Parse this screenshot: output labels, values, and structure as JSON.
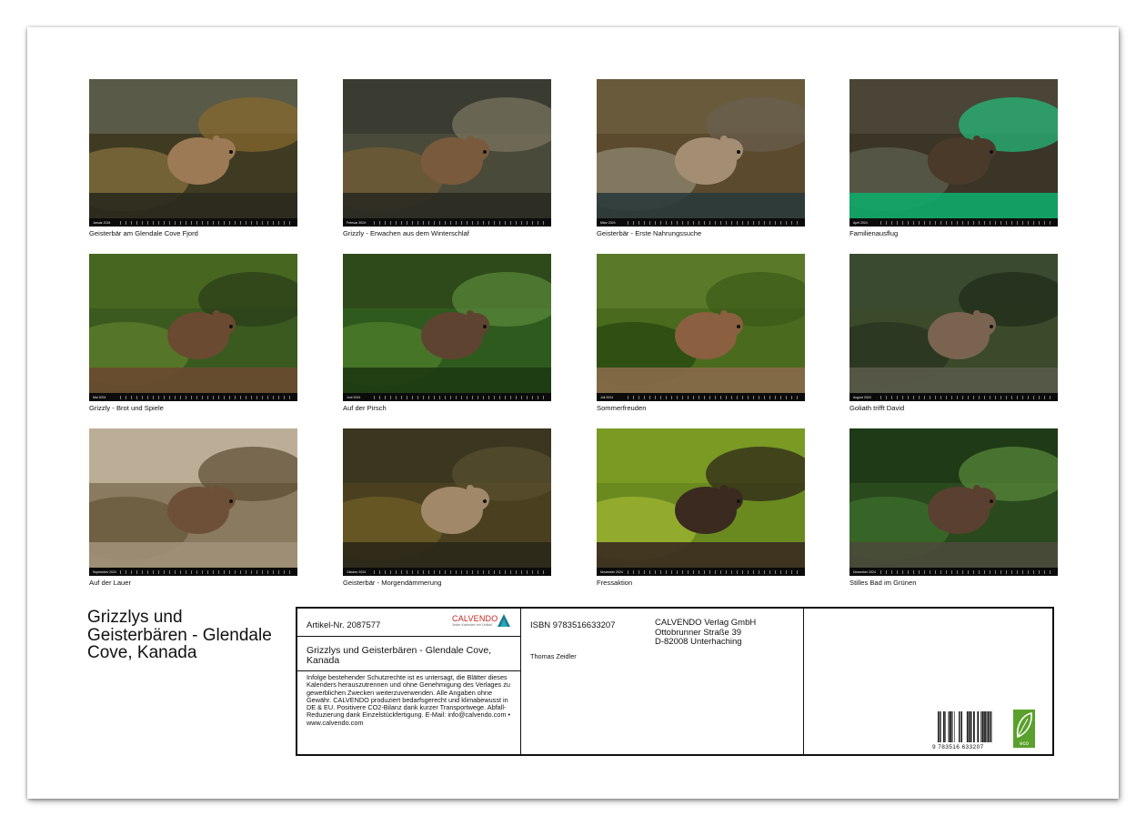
{
  "months": [
    {
      "caption": "Geisterbär am Glendale Cove Fjord",
      "strip": "Januar 2024",
      "colors": [
        "#3f3a22",
        "#7b6a3a",
        "#2a2a1e",
        "#8a6a2e"
      ],
      "bear": "#9c7a55",
      "top": "#5a5a48"
    },
    {
      "caption": "Grizzly - Erwachen aus dem Winterschlaf",
      "strip": "Februar 2024",
      "colors": [
        "#4a4a3a",
        "#6e5a36",
        "#2b2a22",
        "#7c7660"
      ],
      "bear": "#7a5a3c",
      "top": "#3a3c32"
    },
    {
      "caption": "Geisterbär - Erste Nahrungssuche",
      "strip": "März 2024",
      "colors": [
        "#5b4a2e",
        "#8a8068",
        "#2a3a3a",
        "#6a6050"
      ],
      "bear": "#a38e74",
      "top": "#6a5a3c"
    },
    {
      "caption": "Familienausflug",
      "strip": "April 2024",
      "colors": [
        "#3b3528",
        "#5a5a4a",
        "#0faa6a",
        "#22c07e"
      ],
      "bear": "#4a3a2a",
      "top": "#4a4536"
    },
    {
      "caption": "Grizzly - Brot und Spiele",
      "strip": "Mai 2024",
      "colors": [
        "#3a5a20",
        "#5a7a2a",
        "#6a4a30",
        "#2a3a18"
      ],
      "bear": "#6a4a30",
      "top": "#47661f"
    },
    {
      "caption": "Auf der Pirsch",
      "strip": "Juni 2024",
      "colors": [
        "#2f5a1e",
        "#4a7a2a",
        "#1e3a12",
        "#5a8a3a"
      ],
      "bear": "#5e4430",
      "top": "#2f4a1a"
    },
    {
      "caption": "Sommerfreuden",
      "strip": "Juli 2024",
      "colors": [
        "#4a6a1e",
        "#2a4a12",
        "#8a6a4a",
        "#3a5a18"
      ],
      "bear": "#8a6040",
      "top": "#5a7a2a"
    },
    {
      "caption": "Goliath trifft David",
      "strip": "August 2024",
      "colors": [
        "#3a4a2a",
        "#2a3520",
        "#5a5a4a",
        "#1e2a18"
      ],
      "bear": "#7a6450",
      "top": "#3a4a30"
    },
    {
      "caption": "Auf der Lauer",
      "strip": "September 2024",
      "colors": [
        "#8a7a60",
        "#6a5a3e",
        "#a09078",
        "#5a4a30"
      ],
      "bear": "#6e5038",
      "top": "#bcae96"
    },
    {
      "caption": "Geisterbär - Morgendämmerung",
      "strip": "Oktober 2024",
      "colors": [
        "#4a4020",
        "#6a5a26",
        "#2a2818",
        "#5a5030"
      ],
      "bear": "#a08868",
      "top": "#3a3620"
    },
    {
      "caption": "Fressaktion",
      "strip": "November 2024",
      "colors": [
        "#6a8a20",
        "#9ab030",
        "#3a2a20",
        "#2a2018"
      ],
      "bear": "#3a2a20",
      "top": "#7a9a24"
    },
    {
      "caption": "Stilles Bad im Grünen",
      "strip": "Dezember 2024",
      "colors": [
        "#2a4a1e",
        "#3a6a2a",
        "#4a4a3a",
        "#5a8a3a"
      ],
      "bear": "#5a4030",
      "top": "#1e3a16"
    }
  ],
  "title": "Grizzlys und Geisterbären - Glendale Cove, Kanada",
  "info": {
    "article_no": "Artikel-Nr. 2087577",
    "logo_text": "CALVENDO",
    "logo_sub": "Jeder Kalender ein Unikat",
    "book_title": "Grizzlys und Geisterbären - Glendale Cove, Kanada",
    "legal": "Infolge bestehender Schutzrechte ist es untersagt, die Blätter dieses Kalenders herauszutrennen und ohne Genehmigung des Verlages zu gewerblichen Zwecken weiterzuverwenden. Alle Angaben ohne Gewähr. CALVENDO produziert bedarfsgerecht und klimabewusst in DE & EU. Positivere CO2-Bilanz dank kurzer Transportwege. Abfall-Reduzierung dank Einzelstückfertigung. E-Mail: info@calvendo.com • www.calvendo.com",
    "isbn": "ISBN 9783516633207",
    "author": "Thomas Zeidler",
    "publisher_line1": "CALVENDO Verlag GmbH",
    "publisher_line2": "Ottobrunner Straße 39",
    "publisher_line3": "D-82008 Unterhaching",
    "barcode_number": "9 783516 633207",
    "eco_label": "eco"
  },
  "colors": {
    "logo_red": "#c2261f",
    "eco_green": "#5aa02c"
  }
}
